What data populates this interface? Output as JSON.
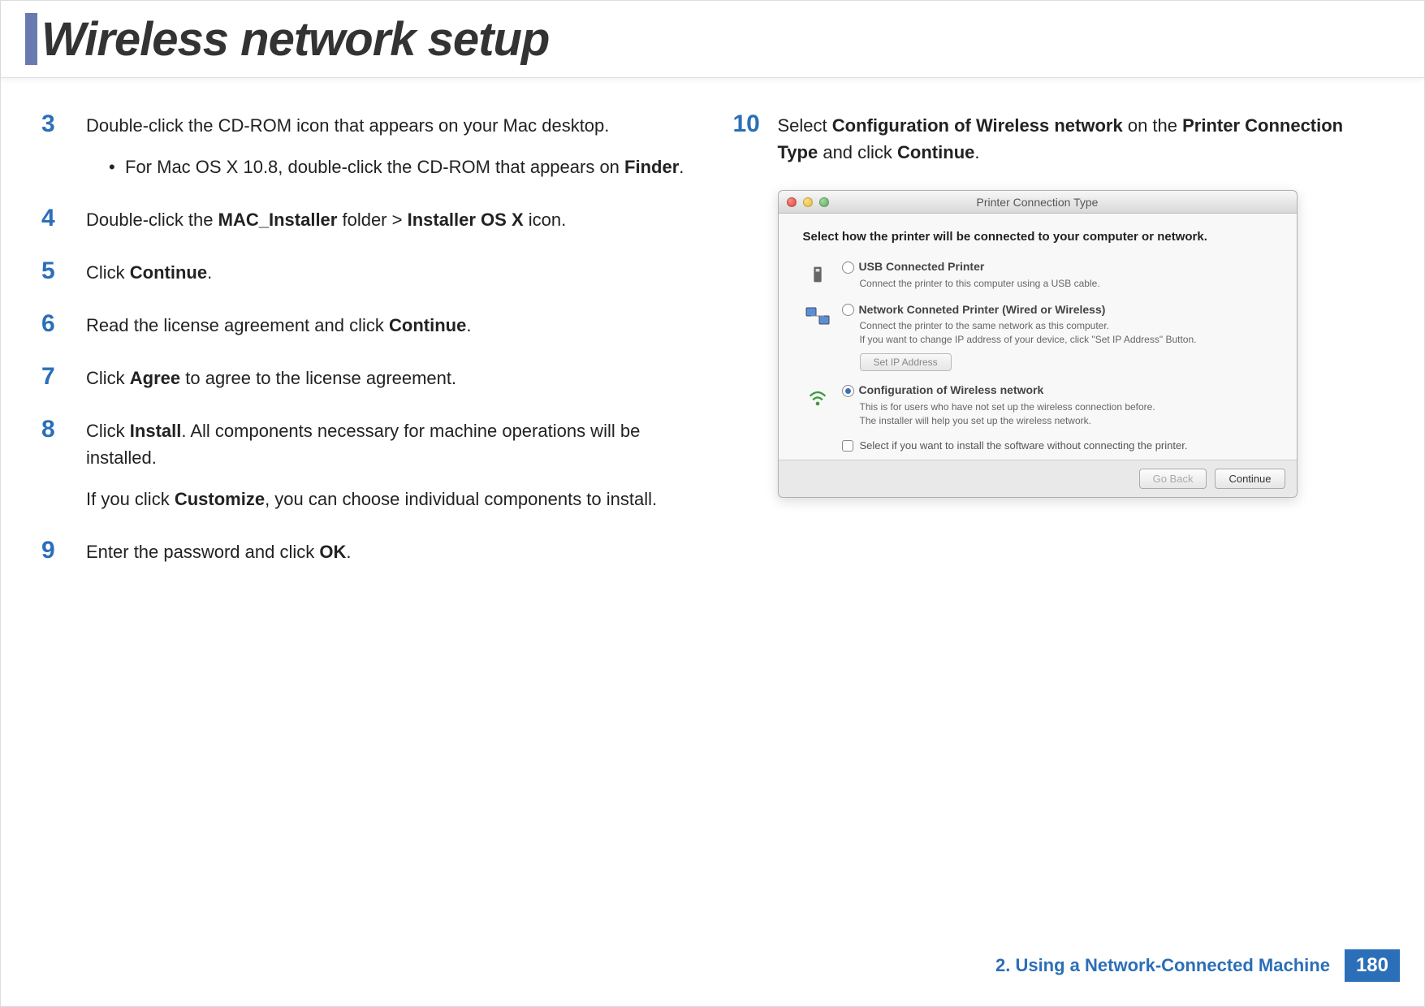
{
  "header": {
    "title": "Wireless network setup"
  },
  "steps_left": [
    {
      "num": "3",
      "parts": [
        "Double-click the CD-ROM icon that appears on your Mac desktop."
      ],
      "bullets": [
        {
          "dot": "•",
          "parts": [
            "For Mac OS X 10.8, double-click the CD-ROM that appears on ",
            {
              "b": "Finder"
            },
            "."
          ]
        }
      ]
    },
    {
      "num": "4",
      "parts": [
        "Double-click the ",
        {
          "b": "MAC_Installer"
        },
        " folder > ",
        {
          "b": "Installer OS X"
        },
        " icon."
      ]
    },
    {
      "num": "5",
      "parts": [
        "Click ",
        {
          "b": "Continue"
        },
        "."
      ]
    },
    {
      "num": "6",
      "parts": [
        "Read the license agreement and click ",
        {
          "b": "Continue"
        },
        "."
      ]
    },
    {
      "num": "7",
      "parts": [
        "Click ",
        {
          "b": "Agree"
        },
        " to agree to the license agreement."
      ]
    },
    {
      "num": "8",
      "parts": [
        "Click ",
        {
          "b": "Install"
        },
        ". All components necessary for machine operations will be installed."
      ],
      "extra_parts": [
        "If you click ",
        {
          "b": "Customize"
        },
        ", you can choose individual components to install."
      ]
    },
    {
      "num": "9",
      "parts": [
        "Enter the password and click ",
        {
          "b": "OK"
        },
        "."
      ]
    }
  ],
  "steps_right": [
    {
      "num": "10",
      "parts": [
        "Select ",
        {
          "b": "Configuration of Wireless network"
        },
        "  on the ",
        {
          "b": "Printer Connection Type"
        },
        " and click ",
        {
          "b": "Continue"
        },
        "."
      ]
    }
  ],
  "dialog": {
    "title": "Printer Connection Type",
    "heading": "Select how the printer will be connected to your computer or network.",
    "options": [
      {
        "icon": "usb",
        "checked": false,
        "label": "USB Connected Printer",
        "desc": "Connect the printer to this computer using a USB cable."
      },
      {
        "icon": "network",
        "checked": false,
        "label": "Network Conneted Printer (Wired or Wireless)",
        "desc": "Connect the printer to the same network as this computer.\nIf you want to change IP address of your device, click \"Set IP Address\" Button.",
        "button": "Set IP Address"
      },
      {
        "icon": "wifi",
        "checked": true,
        "label": "Configuration of Wireless network",
        "desc": "This is for users who have not set up the wireless connection before.\nThe installer will help you set up the wireless network."
      }
    ],
    "checkbox_label": "Select if you want to install the software without connecting the printer.",
    "buttons": {
      "back": "Go Back",
      "continue": "Continue"
    }
  },
  "footer": {
    "chapter": "2.  Using a Network-Connected Machine",
    "page": "180"
  }
}
